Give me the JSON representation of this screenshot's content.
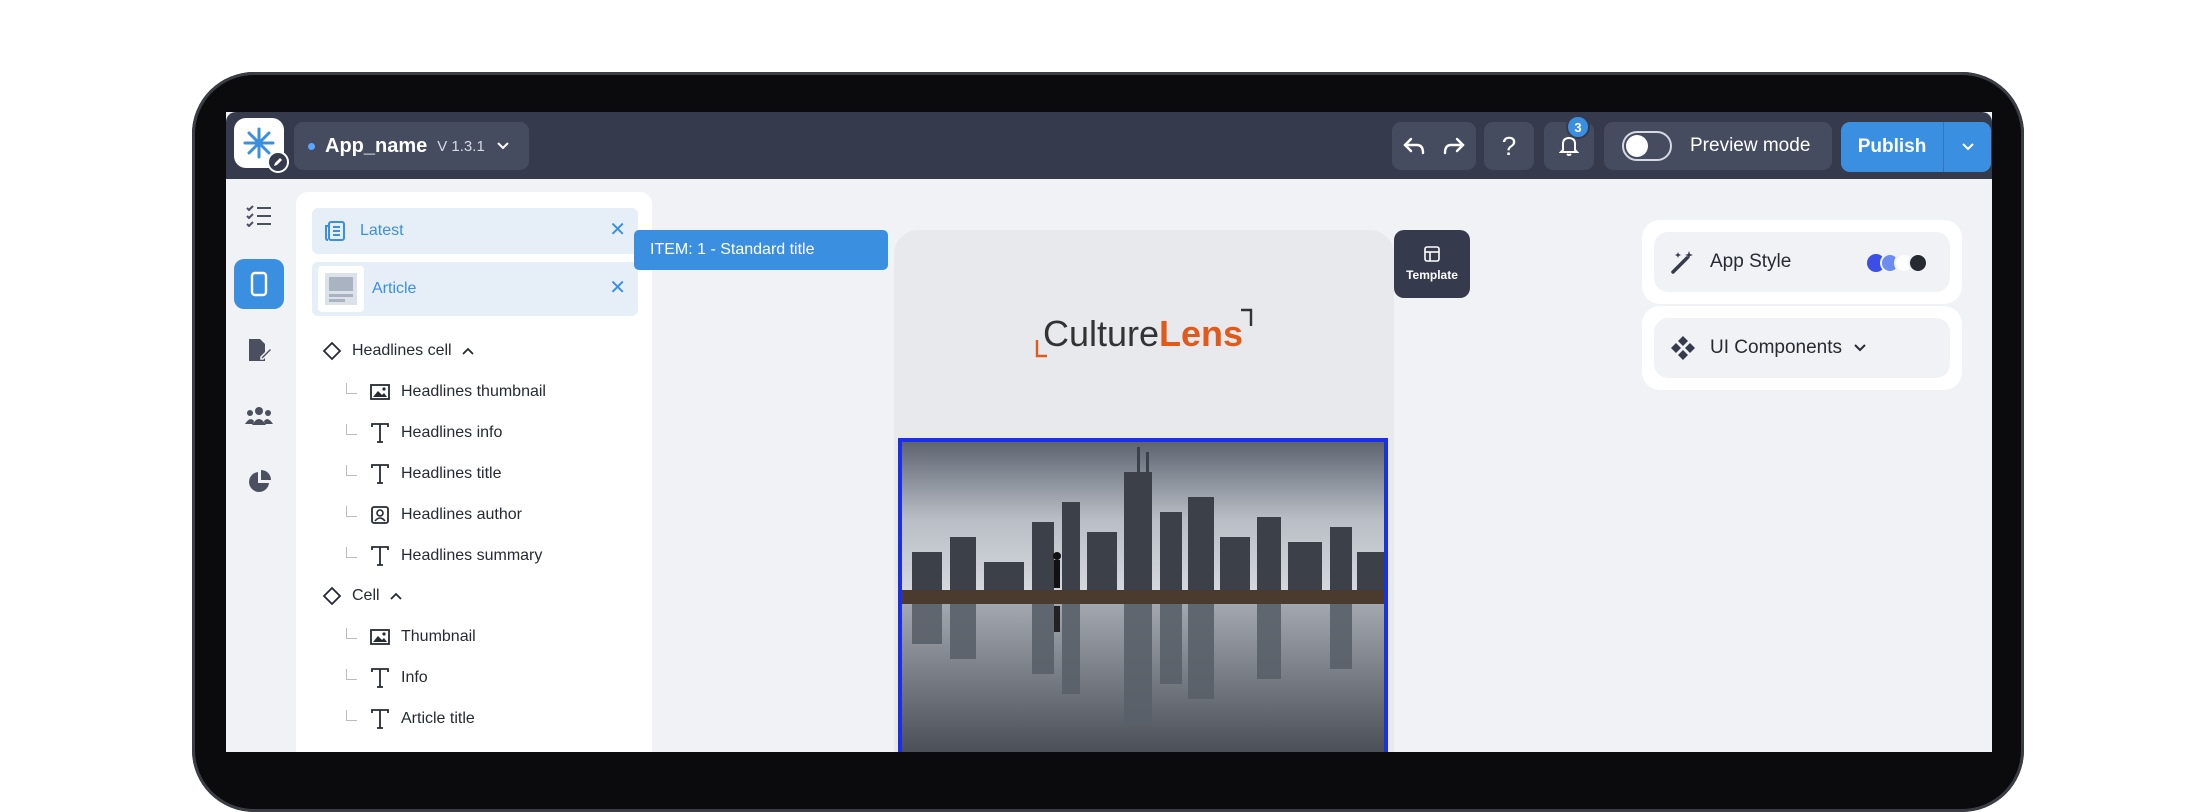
{
  "topbar": {
    "app_name": "App_name",
    "version": "V 1.3.1",
    "help_label": "?",
    "notification_count": "3",
    "preview_label": "Preview mode",
    "publish_label": "Publish"
  },
  "tabs": [
    {
      "label": "Latest"
    },
    {
      "label": "Article"
    }
  ],
  "close_symbol": "✕",
  "tree": {
    "group1": "Headlines cell",
    "group1_items": [
      "Headlines thumbnail",
      "Headlines info",
      "Headlines title",
      "Headlines author",
      "Headlines summary"
    ],
    "group2": "Cell",
    "group2_items": [
      "Thumbnail",
      "Info",
      "Article title"
    ]
  },
  "canvas": {
    "item_label": "ITEM:  1 - Standard title",
    "logo_part1": "Culture",
    "logo_part2": "Lens",
    "template_label": "Template"
  },
  "right_panel": {
    "app_style": "App Style",
    "ui_components": "UI Components"
  },
  "colors": {
    "topbar": "#353b4d",
    "accent": "#3b8fe0",
    "selection": "#1b2fe6",
    "brand_orange": "#e05a1c"
  }
}
